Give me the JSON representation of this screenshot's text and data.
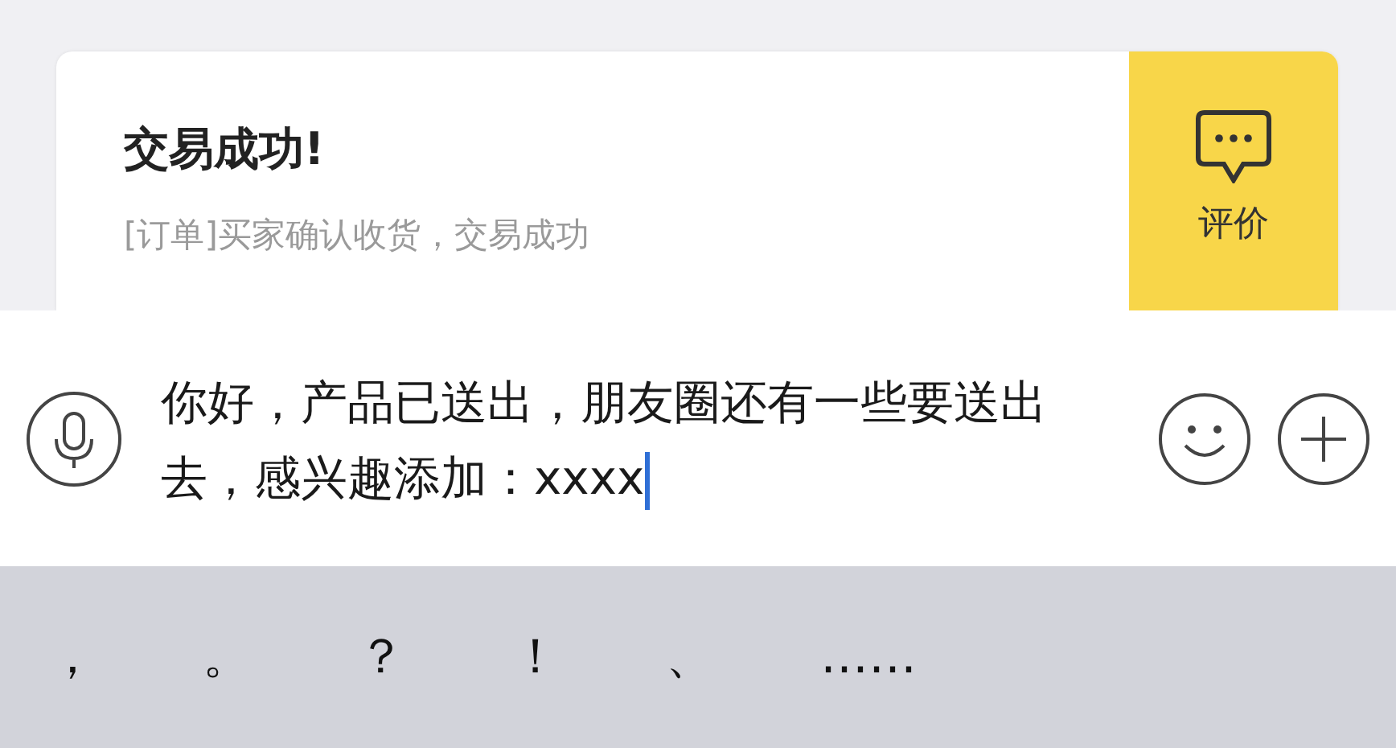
{
  "notification": {
    "title": "交易成功!",
    "subtitle": "[订单]买家确认收货，交易成功",
    "action": "评价"
  },
  "input": {
    "value": "你好，产品已送出，朋友圈还有一些要送出去，感兴趣添加：xxxx"
  },
  "keys": [
    "，",
    "。",
    "？",
    "！",
    "、",
    "……"
  ]
}
